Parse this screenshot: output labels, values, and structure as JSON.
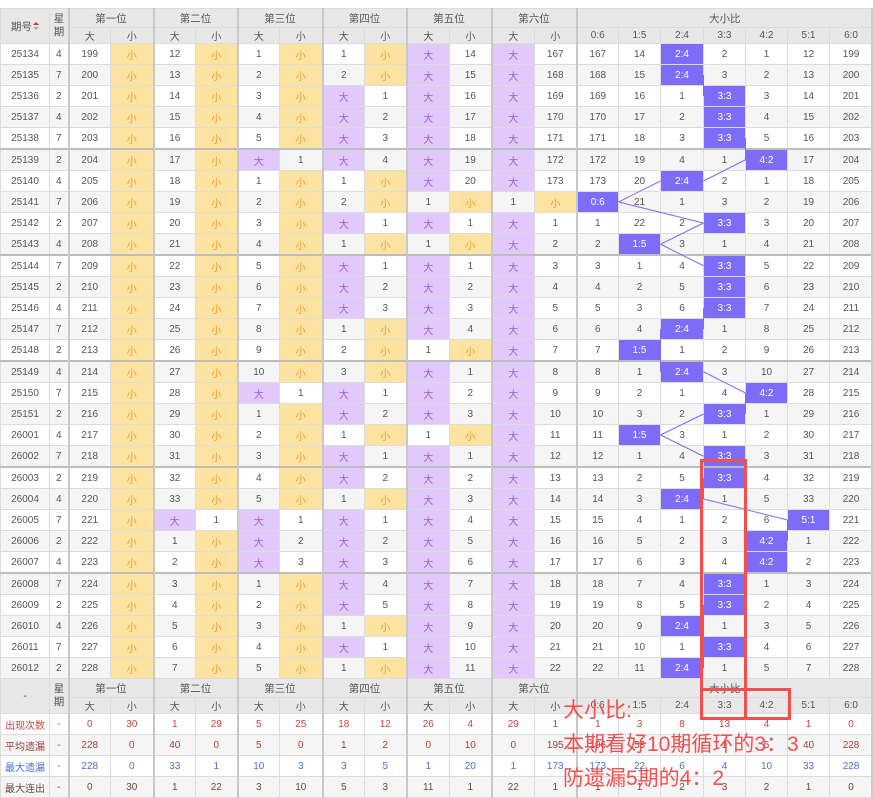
{
  "header": {
    "issue": "期号",
    "weekday_top": "星",
    "weekday_bottom": "期",
    "positions": [
      "第一位",
      "第二位",
      "第三位",
      "第四位",
      "第五位",
      "第六位"
    ],
    "big": "大",
    "small": "小",
    "ratio_title": "大小比",
    "ratio_labels": [
      "0:6",
      "1:5",
      "2:4",
      "3:3",
      "4:2",
      "5:1",
      "6:0"
    ]
  },
  "footer_header": {
    "first": "-"
  },
  "colors": {
    "small_hit": "#fde3a1",
    "big_hit": "#e2c9fb",
    "ratio_hit": "#7d6cf8",
    "annotation": "#f25050"
  },
  "rows": [
    {
      "issue": "25134",
      "wd": "4",
      "cells": [
        "199",
        "小",
        "12",
        "小",
        "1",
        "小",
        "1",
        "小",
        "大",
        "14",
        "大",
        "167",
        "167",
        "14",
        "2:4",
        "2",
        "1",
        "12",
        "199"
      ]
    },
    {
      "issue": "25135",
      "wd": "7",
      "cells": [
        "200",
        "小",
        "13",
        "小",
        "2",
        "小",
        "2",
        "小",
        "大",
        "15",
        "大",
        "168",
        "168",
        "15",
        "2:4",
        "3",
        "2",
        "13",
        "200"
      ]
    },
    {
      "issue": "25136",
      "wd": "2",
      "cells": [
        "201",
        "小",
        "14",
        "小",
        "3",
        "小",
        "大",
        "1",
        "大",
        "16",
        "大",
        "169",
        "169",
        "16",
        "1",
        "3:3",
        "3",
        "14",
        "201"
      ]
    },
    {
      "issue": "25137",
      "wd": "4",
      "cells": [
        "202",
        "小",
        "15",
        "小",
        "4",
        "小",
        "大",
        "2",
        "大",
        "17",
        "大",
        "170",
        "170",
        "17",
        "2",
        "3:3",
        "4",
        "15",
        "202"
      ]
    },
    {
      "issue": "25138",
      "wd": "7",
      "cells": [
        "203",
        "小",
        "16",
        "小",
        "5",
        "小",
        "大",
        "3",
        "大",
        "18",
        "大",
        "171",
        "171",
        "18",
        "3",
        "3:3",
        "5",
        "16",
        "203"
      ]
    },
    {
      "issue": "25139",
      "wd": "2",
      "cells": [
        "204",
        "小",
        "17",
        "小",
        "大",
        "1",
        "大",
        "4",
        "大",
        "19",
        "大",
        "172",
        "172",
        "19",
        "4",
        "1",
        "4:2",
        "17",
        "204"
      ]
    },
    {
      "issue": "25140",
      "wd": "4",
      "cells": [
        "205",
        "小",
        "18",
        "小",
        "1",
        "小",
        "1",
        "小",
        "大",
        "20",
        "大",
        "173",
        "173",
        "20",
        "2:4",
        "2",
        "1",
        "18",
        "205"
      ]
    },
    {
      "issue": "25141",
      "wd": "7",
      "cells": [
        "206",
        "小",
        "19",
        "小",
        "2",
        "小",
        "2",
        "小",
        "1",
        "小",
        "1",
        "小",
        "0:6",
        "21",
        "1",
        "3",
        "2",
        "19",
        "206"
      ]
    },
    {
      "issue": "25142",
      "wd": "2",
      "cells": [
        "207",
        "小",
        "20",
        "小",
        "3",
        "小",
        "大",
        "1",
        "大",
        "1",
        "大",
        "1",
        "1",
        "22",
        "2",
        "3:3",
        "3",
        "20",
        "207"
      ]
    },
    {
      "issue": "25143",
      "wd": "4",
      "cells": [
        "208",
        "小",
        "21",
        "小",
        "4",
        "小",
        "1",
        "小",
        "1",
        "小",
        "大",
        "2",
        "2",
        "1:5",
        "3",
        "1",
        "4",
        "21",
        "208"
      ]
    },
    {
      "issue": "25144",
      "wd": "7",
      "cells": [
        "209",
        "小",
        "22",
        "小",
        "5",
        "小",
        "大",
        "1",
        "大",
        "1",
        "大",
        "3",
        "3",
        "1",
        "4",
        "3:3",
        "5",
        "22",
        "209"
      ]
    },
    {
      "issue": "25145",
      "wd": "2",
      "cells": [
        "210",
        "小",
        "23",
        "小",
        "6",
        "小",
        "大",
        "2",
        "大",
        "2",
        "大",
        "4",
        "4",
        "2",
        "5",
        "3:3",
        "6",
        "23",
        "210"
      ]
    },
    {
      "issue": "25146",
      "wd": "4",
      "cells": [
        "211",
        "小",
        "24",
        "小",
        "7",
        "小",
        "大",
        "3",
        "大",
        "3",
        "大",
        "5",
        "5",
        "3",
        "6",
        "3:3",
        "7",
        "24",
        "211"
      ]
    },
    {
      "issue": "25147",
      "wd": "7",
      "cells": [
        "212",
        "小",
        "25",
        "小",
        "8",
        "小",
        "1",
        "小",
        "大",
        "4",
        "大",
        "6",
        "6",
        "4",
        "2:4",
        "1",
        "8",
        "25",
        "212"
      ]
    },
    {
      "issue": "25148",
      "wd": "2",
      "cells": [
        "213",
        "小",
        "26",
        "小",
        "9",
        "小",
        "2",
        "小",
        "1",
        "小",
        "大",
        "7",
        "7",
        "1:5",
        "1",
        "2",
        "9",
        "26",
        "213"
      ]
    },
    {
      "issue": "25149",
      "wd": "4",
      "cells": [
        "214",
        "小",
        "27",
        "小",
        "10",
        "小",
        "3",
        "小",
        "大",
        "1",
        "大",
        "8",
        "8",
        "1",
        "2:4",
        "3",
        "10",
        "27",
        "214"
      ]
    },
    {
      "issue": "25150",
      "wd": "7",
      "cells": [
        "215",
        "小",
        "28",
        "小",
        "大",
        "1",
        "大",
        "1",
        "大",
        "2",
        "大",
        "9",
        "9",
        "2",
        "1",
        "4",
        "4:2",
        "28",
        "215"
      ]
    },
    {
      "issue": "25151",
      "wd": "2",
      "cells": [
        "216",
        "小",
        "29",
        "小",
        "1",
        "小",
        "大",
        "2",
        "大",
        "3",
        "大",
        "10",
        "10",
        "3",
        "2",
        "3:3",
        "1",
        "29",
        "216"
      ]
    },
    {
      "issue": "26001",
      "wd": "4",
      "cells": [
        "217",
        "小",
        "30",
        "小",
        "2",
        "小",
        "1",
        "小",
        "1",
        "小",
        "大",
        "11",
        "11",
        "1:5",
        "3",
        "1",
        "2",
        "30",
        "217"
      ]
    },
    {
      "issue": "26002",
      "wd": "7",
      "cells": [
        "218",
        "小",
        "31",
        "小",
        "3",
        "小",
        "大",
        "1",
        "大",
        "1",
        "大",
        "12",
        "12",
        "1",
        "4",
        "3:3",
        "3",
        "31",
        "218"
      ]
    },
    {
      "issue": "26003",
      "wd": "2",
      "cells": [
        "219",
        "小",
        "32",
        "小",
        "4",
        "小",
        "大",
        "2",
        "大",
        "2",
        "大",
        "13",
        "13",
        "2",
        "5",
        "3:3",
        "4",
        "32",
        "219"
      ]
    },
    {
      "issue": "26004",
      "wd": "4",
      "cells": [
        "220",
        "小",
        "33",
        "小",
        "5",
        "小",
        "1",
        "小",
        "大",
        "3",
        "大",
        "14",
        "14",
        "3",
        "2:4",
        "1",
        "5",
        "33",
        "220"
      ]
    },
    {
      "issue": "26005",
      "wd": "7",
      "cells": [
        "221",
        "小",
        "大",
        "1",
        "大",
        "1",
        "大",
        "1",
        "大",
        "4",
        "大",
        "15",
        "15",
        "4",
        "1",
        "2",
        "6",
        "5:1",
        "221"
      ]
    },
    {
      "issue": "26006",
      "wd": "2",
      "cells": [
        "222",
        "小",
        "1",
        "小",
        "大",
        "2",
        "大",
        "2",
        "大",
        "5",
        "大",
        "16",
        "16",
        "5",
        "2",
        "3",
        "4:2",
        "1",
        "222"
      ]
    },
    {
      "issue": "26007",
      "wd": "4",
      "cells": [
        "223",
        "小",
        "2",
        "小",
        "大",
        "3",
        "大",
        "3",
        "大",
        "6",
        "大",
        "17",
        "17",
        "6",
        "3",
        "4",
        "4:2",
        "2",
        "223"
      ]
    },
    {
      "issue": "26008",
      "wd": "7",
      "cells": [
        "224",
        "小",
        "3",
        "小",
        "1",
        "小",
        "大",
        "4",
        "大",
        "7",
        "大",
        "18",
        "18",
        "7",
        "4",
        "3:3",
        "1",
        "3",
        "224"
      ]
    },
    {
      "issue": "26009",
      "wd": "2",
      "cells": [
        "225",
        "小",
        "4",
        "小",
        "2",
        "小",
        "大",
        "5",
        "大",
        "8",
        "大",
        "19",
        "19",
        "8",
        "5",
        "3:3",
        "2",
        "4",
        "225"
      ]
    },
    {
      "issue": "26010",
      "wd": "4",
      "cells": [
        "226",
        "小",
        "5",
        "小",
        "3",
        "小",
        "1",
        "小",
        "大",
        "9",
        "大",
        "20",
        "20",
        "9",
        "2:4",
        "1",
        "3",
        "5",
        "226"
      ]
    },
    {
      "issue": "26011",
      "wd": "7",
      "cells": [
        "227",
        "小",
        "6",
        "小",
        "4",
        "小",
        "大",
        "1",
        "大",
        "10",
        "大",
        "21",
        "21",
        "10",
        "1",
        "3:3",
        "4",
        "6",
        "227"
      ]
    },
    {
      "issue": "26012",
      "wd": "2",
      "cells": [
        "228",
        "小",
        "7",
        "小",
        "5",
        "小",
        "1",
        "小",
        "大",
        "11",
        "大",
        "22",
        "22",
        "11",
        "2:4",
        "1",
        "5",
        "7",
        "228"
      ]
    }
  ],
  "stats": [
    {
      "label": "出现次数",
      "wd": "-",
      "values": [
        "0",
        "30",
        "1",
        "29",
        "5",
        "25",
        "18",
        "12",
        "26",
        "4",
        "29",
        "1",
        "1",
        "3",
        "8",
        "13",
        "4",
        "1",
        "0"
      ]
    },
    {
      "label": "平均遗漏",
      "wd": "-",
      "values": [
        "228",
        "0",
        "40",
        "0",
        "5",
        "0",
        "1",
        "2",
        "0",
        "10",
        "0",
        "195",
        "106",
        "53",
        "3",
        "1",
        "5",
        "40",
        "228"
      ]
    },
    {
      "label": "最大遗漏",
      "wd": "-",
      "values": [
        "228",
        "0",
        "33",
        "1",
        "10",
        "3",
        "3",
        "5",
        "1",
        "20",
        "1",
        "173",
        "173",
        "22",
        "6",
        "4",
        "10",
        "33",
        "228"
      ]
    },
    {
      "label": "最大连出",
      "wd": "-",
      "values": [
        "0",
        "30",
        "1",
        "22",
        "3",
        "10",
        "5",
        "3",
        "11",
        "1",
        "22",
        "1",
        "1",
        "1",
        "2",
        "3",
        "2",
        "1",
        "0"
      ]
    }
  ],
  "annotation": {
    "line1": "大小比:",
    "line2": "本期看好10期循环的3：3",
    "line3": "防遗漏5期的4：2"
  }
}
